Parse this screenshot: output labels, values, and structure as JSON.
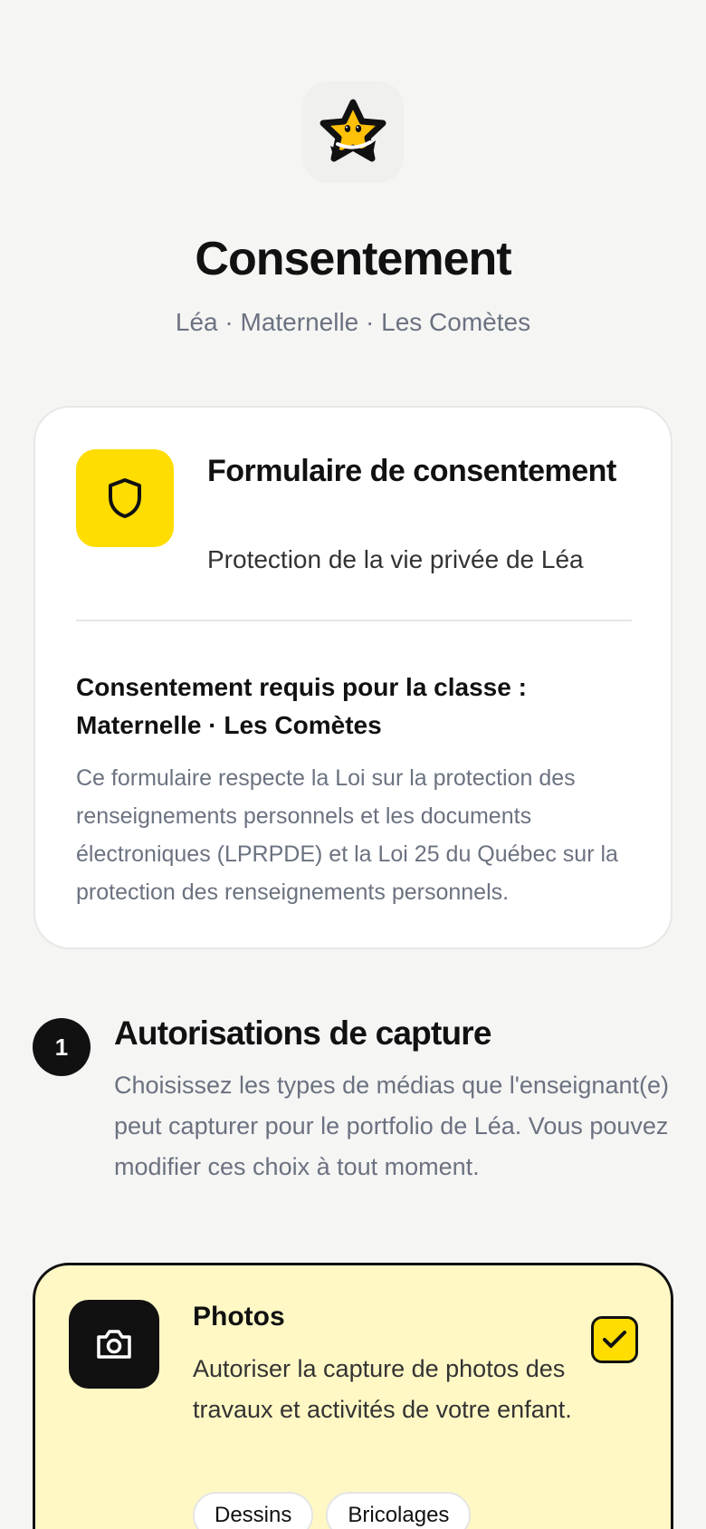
{
  "header": {
    "title": "Consentement",
    "subtitle": "Léa · Maternelle · Les Comètes"
  },
  "consent_card": {
    "title": "Formulaire de consentement",
    "subtitle": "Protection de la vie privée de Léa",
    "required_title": "Consentement requis pour la classe : Maternelle · Les Comètes",
    "legal_text": "Ce formulaire respecte la Loi sur la protection des renseignements personnels et les documents électroniques (LPRPDE) et la Loi 25 du Québec sur la protection des renseignements personnels."
  },
  "step1": {
    "number": "1",
    "title": "Autorisations de capture",
    "description": "Choisissez les types de médias que l'enseignant(e) peut capturer pour le portfolio de Léa. Vous pouvez modifier ces choix à tout moment."
  },
  "photos_option": {
    "title": "Photos",
    "description": "Autoriser la capture de photos des travaux et activités de votre enfant.",
    "checked": true,
    "tags": [
      "Dessins",
      "Bricolages"
    ]
  },
  "colors": {
    "brand_yellow": "#ffdd00",
    "selected_card_bg": "#fff8c5",
    "text_dark": "#111111",
    "text_muted": "#6b7280"
  }
}
